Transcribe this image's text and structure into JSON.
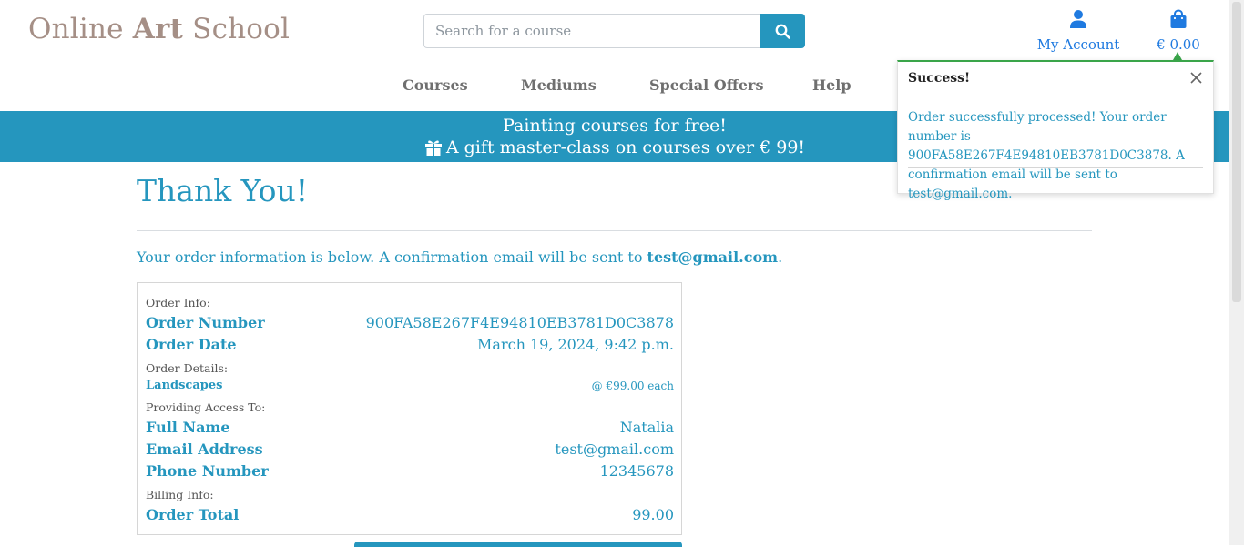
{
  "header": {
    "logo_part1": "Online ",
    "logo_part2": "Art",
    "logo_part3": " School",
    "search_placeholder": "Search for a course",
    "account_label": "My Account",
    "cart_total": "€ 0.00"
  },
  "nav": [
    "Courses",
    "Mediums",
    "Special Offers",
    "Help"
  ],
  "banner": {
    "line1": "Painting courses for free!",
    "line2": "A gift master-class on courses over € 99!"
  },
  "page": {
    "title": "Thank You!",
    "intro_text": "Your order information is below. A confirmation email will be sent to ",
    "intro_email": "test@gmail.com",
    "intro_end": "."
  },
  "order": {
    "order_info_label": "Order Info:",
    "order_number_label": "Order Number",
    "order_number": "900FA58E267F4E94810EB3781D0C3878",
    "order_date_label": "Order Date",
    "order_date": "March 19, 2024, 9:42 p.m.",
    "order_details_label": "Order Details:",
    "item_name": "Landscapes",
    "item_price": "@ €99.00 each",
    "access_label": "Providing Access To:",
    "full_name_label": "Full Name",
    "full_name": "Natalia",
    "email_label": "Email Address",
    "email": "test@gmail.com",
    "phone_label": "Phone Number",
    "phone": "12345678",
    "billing_label": "Billing Info:",
    "total_label": "Order Total",
    "total": "99.00"
  },
  "toast": {
    "title": "Success!",
    "message": "Order successfully processed! Your order number is 900FA58E267F4E94810EB3781D0C3878. A confirmation email will be sent to test@gmail.com."
  },
  "colors": {
    "accent": "#2596be",
    "logo": "#a58f86",
    "success": "#3aa54a"
  },
  "icons": {
    "search": "search-icon",
    "account": "user-icon",
    "cart": "shopping-bag-icon",
    "gift": "gift-icon",
    "close": "close-icon"
  }
}
